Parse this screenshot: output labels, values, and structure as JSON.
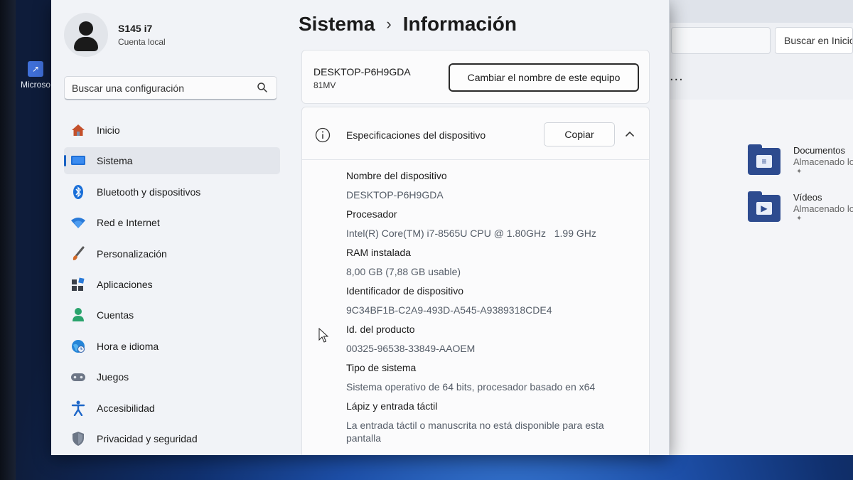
{
  "desktop": {
    "icon_label": "Microso"
  },
  "explorer": {
    "search_label": "Buscar en Inicio",
    "more_label": "...",
    "folders": [
      {
        "name": "Documentos",
        "sub": "Almacenado localmente",
        "icon": "documents-folder-icon"
      },
      {
        "name": "Vídeos",
        "sub": "Almacenado localmente",
        "icon": "videos-folder-icon"
      }
    ]
  },
  "profile": {
    "name": "S145 i7",
    "account_type": "Cuenta local"
  },
  "search": {
    "placeholder": "Buscar una configuración"
  },
  "nav": {
    "items": [
      {
        "label": "Inicio",
        "icon": "home-icon"
      },
      {
        "label": "Sistema",
        "icon": "system-icon",
        "active": true
      },
      {
        "label": "Bluetooth y dispositivos",
        "icon": "bluetooth-icon"
      },
      {
        "label": "Red e Internet",
        "icon": "wifi-icon"
      },
      {
        "label": "Personalización",
        "icon": "brush-icon"
      },
      {
        "label": "Aplicaciones",
        "icon": "apps-icon"
      },
      {
        "label": "Cuentas",
        "icon": "accounts-icon"
      },
      {
        "label": "Hora e idioma",
        "icon": "globe-clock-icon"
      },
      {
        "label": "Juegos",
        "icon": "gamepad-icon"
      },
      {
        "label": "Accesibilidad",
        "icon": "accessibility-icon"
      },
      {
        "label": "Privacidad y seguridad",
        "icon": "shield-icon"
      }
    ]
  },
  "breadcrumb": {
    "parent": "Sistema",
    "separator": "›",
    "current": "Información"
  },
  "device": {
    "name": "DESKTOP-P6H9GDA",
    "model": "81MV",
    "rename_label": "Cambiar el nombre de este equipo"
  },
  "specs": {
    "title": "Especificaciones del dispositivo",
    "copy_label": "Copiar",
    "rows": [
      {
        "label": "Nombre del dispositivo",
        "value": "DESKTOP-P6H9GDA"
      },
      {
        "label": "Procesador",
        "value": "Intel(R) Core(TM) i7-8565U CPU @ 1.80GHz   1.99 GHz"
      },
      {
        "label": "RAM instalada",
        "value": "8,00 GB (7,88 GB usable)"
      },
      {
        "label": "Identificador de dispositivo",
        "value": "9C34BF1B-C2A9-493D-A545-A9389318CDE4"
      },
      {
        "label": "Id. del producto",
        "value": "00325-96538-33849-AAOEM"
      },
      {
        "label": "Tipo de sistema",
        "value": "Sistema operativo de 64 bits, procesador basado en x64"
      },
      {
        "label": "Lápiz y entrada táctil",
        "value": "La entrada táctil o manuscrita no está disponible para esta pantalla"
      }
    ]
  },
  "colors": {
    "accent": "#1a63c4",
    "window_bg": "#f1f3f7",
    "card_bg": "#fbfbfc"
  }
}
